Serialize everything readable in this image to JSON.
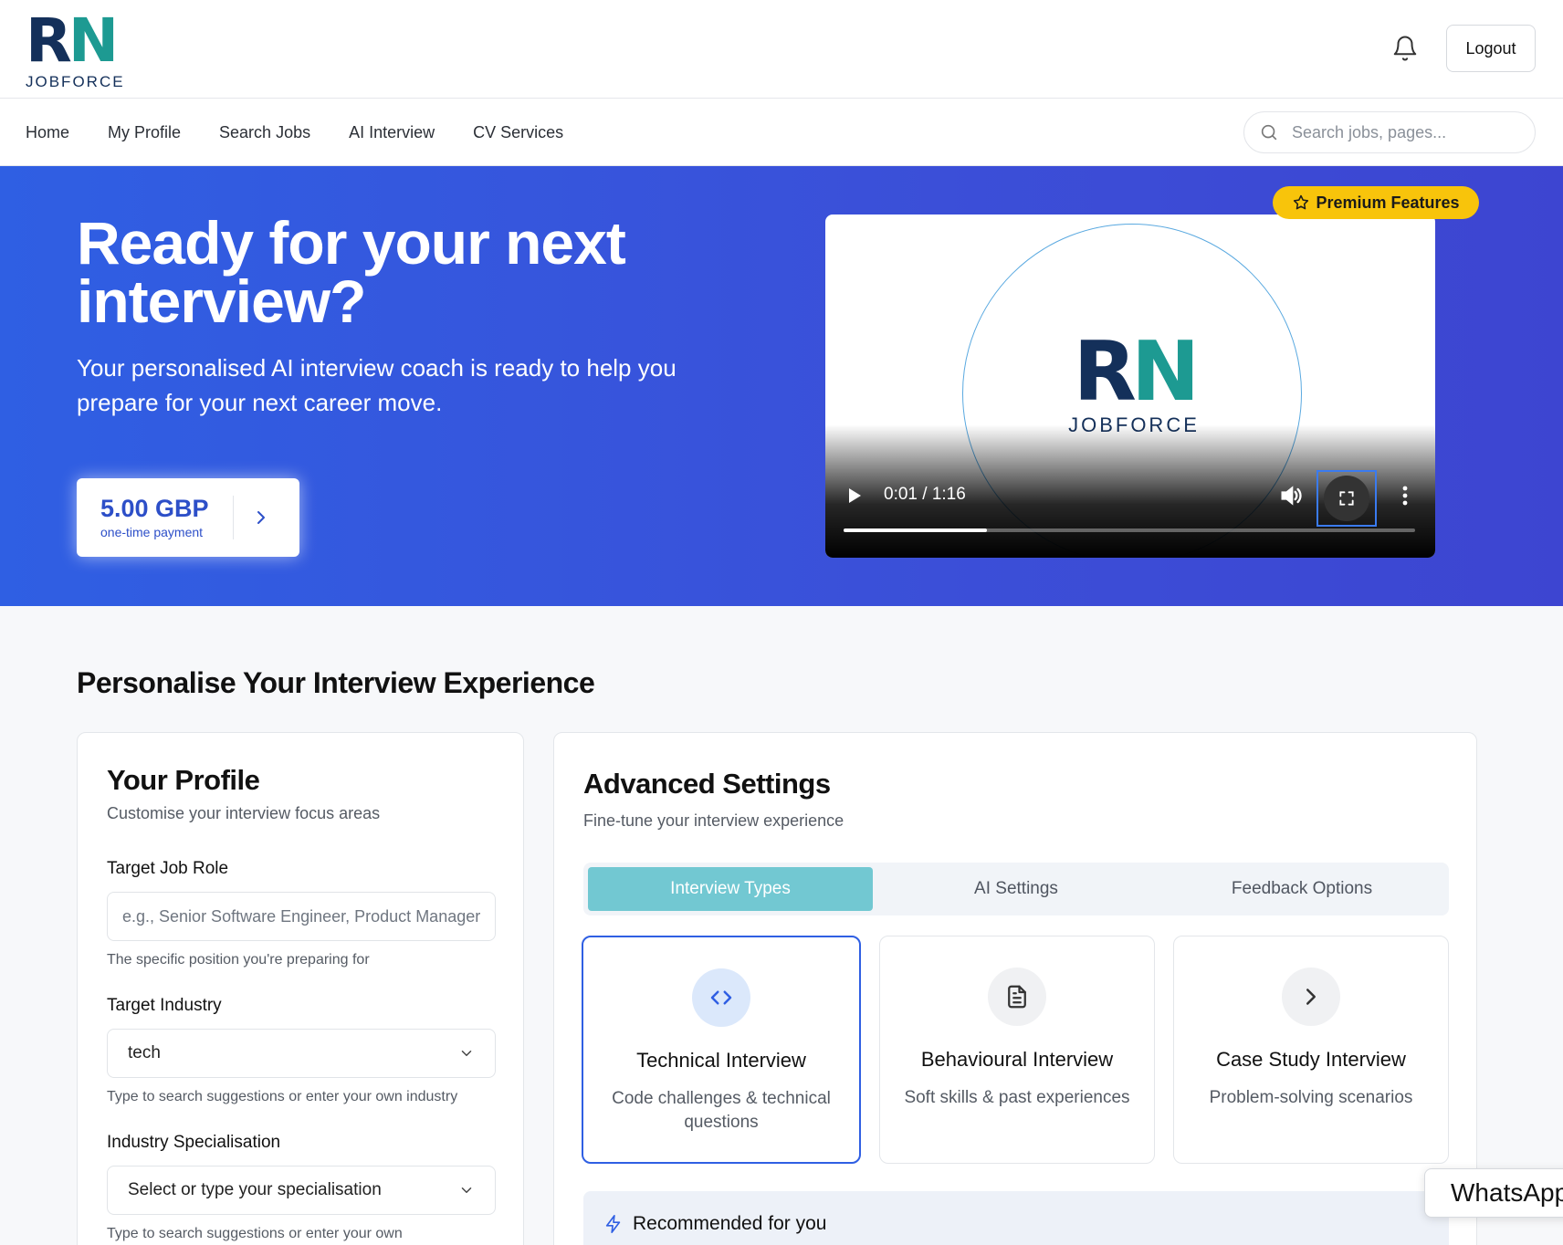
{
  "brand": {
    "rn": [
      "R",
      "N"
    ],
    "sub": "JOBFORCE"
  },
  "header": {
    "logout_label": "Logout"
  },
  "nav": {
    "items": [
      "Home",
      "My Profile",
      "Search Jobs",
      "AI Interview",
      "CV Services"
    ],
    "search_placeholder": "Search jobs, pages..."
  },
  "hero": {
    "title": "Ready for your next interview?",
    "subtitle": "Your personalised AI interview coach is ready to help you prepare for your next career move.",
    "price": "5.00 GBP",
    "price_note": "one-time payment",
    "premium_label": "Premium Features",
    "video": {
      "time": "0:01 / 1:16",
      "progress": 0.25
    }
  },
  "section": {
    "title": "Personalise Your Interview Experience"
  },
  "profile": {
    "title": "Your Profile",
    "subtitle": "Customise your interview focus areas",
    "job_role_label": "Target Job Role",
    "job_role_placeholder": "e.g., Senior Software Engineer, Product Manager",
    "job_role_help": "The specific position you're preparing for",
    "industry_label": "Target Industry",
    "industry_value": "tech",
    "industry_help": "Type to search suggestions or enter your own industry",
    "specialisation_label": "Industry Specialisation",
    "specialisation_value": "Select or type your specialisation",
    "specialisation_help": "Type to search suggestions or enter your own"
  },
  "advanced": {
    "title": "Advanced Settings",
    "subtitle": "Fine-tune your interview experience",
    "tabs": [
      "Interview Types",
      "AI Settings",
      "Feedback Options"
    ],
    "active_tab": 0,
    "types": [
      {
        "title": "Technical Interview",
        "desc": "Code challenges & technical questions",
        "icon": "code-icon",
        "selected": true
      },
      {
        "title": "Behavioural Interview",
        "desc": "Soft skills & past experiences",
        "icon": "document-icon",
        "selected": false
      },
      {
        "title": "Case Study Interview",
        "desc": "Problem-solving scenarios",
        "icon": "chevron-right-icon",
        "selected": false
      }
    ],
    "recommended_label": "Recommended for you"
  },
  "whatsapp_label": "WhatsApp",
  "colors": {
    "brand_navy": "#14305a",
    "brand_teal": "#1d9a92",
    "hero_blue": "#2f5fe3",
    "premium_yellow": "#f8c40b",
    "active_tab": "#72c8d2"
  }
}
